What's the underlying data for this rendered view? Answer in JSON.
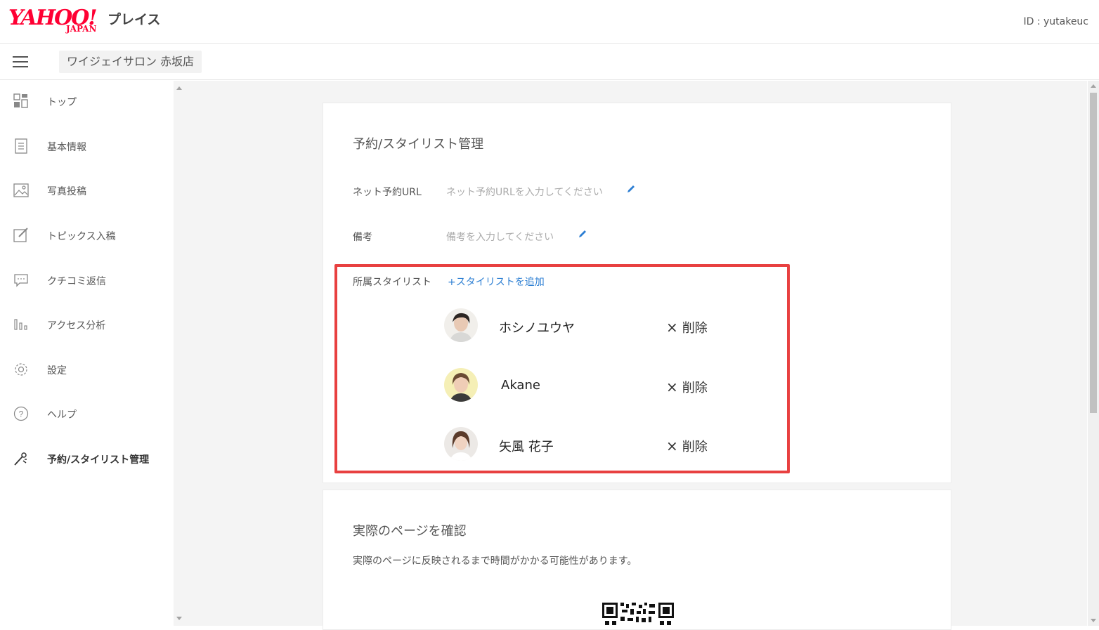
{
  "header": {
    "logo_yahoo": "YAHOO!",
    "logo_japan": "JAPAN",
    "logo_place": "プレイス",
    "user_id": "ID : yutakeuc"
  },
  "subbar": {
    "store_name": "ワイジェイサロン 赤坂店"
  },
  "sidebar": {
    "items": [
      {
        "label": "トップ",
        "icon": "dashboard-icon"
      },
      {
        "label": "基本情報",
        "icon": "document-icon"
      },
      {
        "label": "写真投稿",
        "icon": "image-icon"
      },
      {
        "label": "トピックス入稿",
        "icon": "edit-icon"
      },
      {
        "label": "クチコミ返信",
        "icon": "chat-icon"
      },
      {
        "label": "アクセス分析",
        "icon": "bar-chart-icon"
      },
      {
        "label": "設定",
        "icon": "gear-icon"
      },
      {
        "label": "ヘルプ",
        "icon": "help-icon"
      },
      {
        "label": "予約/スタイリスト管理",
        "icon": "scissors-icon",
        "active": true
      }
    ]
  },
  "reservation_card": {
    "title": "予約/スタイリスト管理",
    "net_url_label": "ネット予約URL",
    "net_url_placeholder": "ネット予約URLを入力してください",
    "notes_label": "備考",
    "notes_placeholder": "備考を入力してください",
    "stylists_label": "所属スタイリスト",
    "add_stylist_label": "+スタイリストを追加",
    "delete_label": "削除",
    "stylists": [
      {
        "name": "ホシノユウヤ"
      },
      {
        "name": "Akane"
      },
      {
        "name": "矢風 花子"
      }
    ]
  },
  "preview_card": {
    "title": "実際のページを確認",
    "description": "実際のページに反映されるまで時間がかかる可能性があります。"
  },
  "colors": {
    "accent_link": "#2d7fd3",
    "highlight": "#e84040",
    "brand_red": "#ff0033"
  }
}
